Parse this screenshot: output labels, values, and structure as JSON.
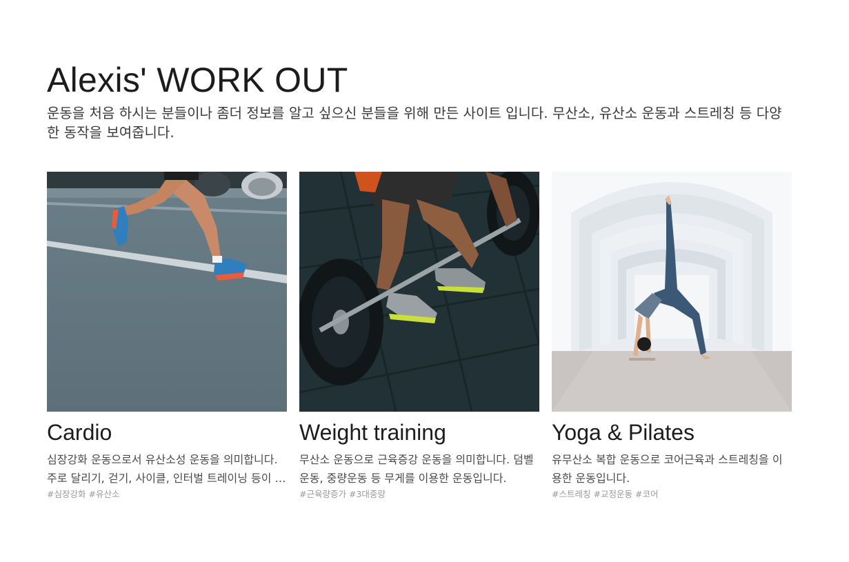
{
  "header": {
    "title": "Alexis' WORK OUT",
    "description": "운동을 처음 하시는 분들이나 좀더 정보를 알고 싶으신 분들을 위해 만든 사이트 입니다. 무산소, 유산소 운동과 스트레칭 등 다양한 동작을 보여줍니다."
  },
  "cards": [
    {
      "title": "Cardio",
      "description": "심장강화 운동으로서 유산소성 운동을 의미합니다. 주로 달리기, 걷기, 사이클, 인터벌 트레이닝 등이 포함됩니다.",
      "tags": [
        "#심장강화",
        "#유산소"
      ],
      "image": "running-photo"
    },
    {
      "title": "Weight training",
      "description": "무산소 운동으로 근육증강 운동을 의미합니다. 덤벨운동, 중량운동 등 무게를 이용한 운동입니다.",
      "tags": [
        "#근육량증가",
        "#3대중량"
      ],
      "image": "barbell-deadlift-photo"
    },
    {
      "title": "Yoga & Pilates",
      "description": "유무산소 복합 운동으로 코어근육과 스트레칭을 이용한 운동입니다.",
      "tags": [
        "#스트레칭",
        "#교정운동",
        "#코어"
      ],
      "image": "yoga-pose-photo"
    }
  ]
}
